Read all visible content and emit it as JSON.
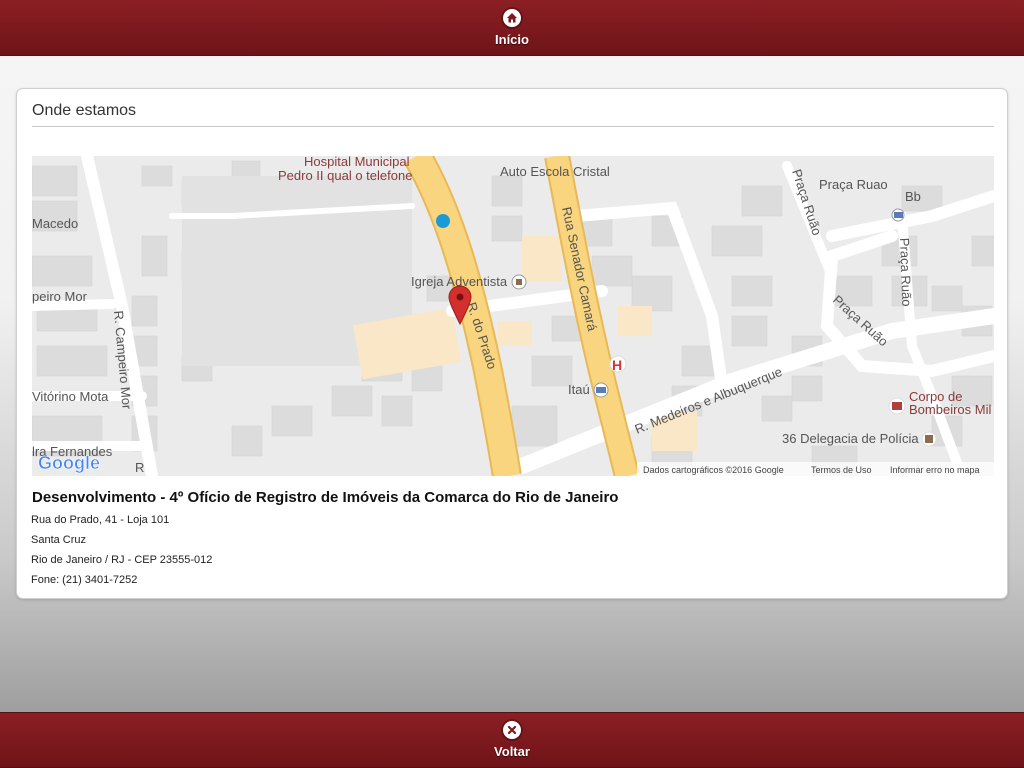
{
  "header": {
    "home_label": "Início",
    "home_icon": "home-icon"
  },
  "card": {
    "title": "Onde estamos",
    "map": {
      "labels": {
        "hospital_line1": "Hospital Municipal",
        "hospital_line2": "Pedro II qual o telefone",
        "auto_escola": "Auto Escola Cristal",
        "praca_ruao_top": "Praça Ruao",
        "bb": "Bb",
        "macedo": "Macedo",
        "igreja": "Igreja Adventista",
        "rua_senador": "Rua Senador Camará",
        "r_do_prado": "R. do Prado",
        "campeiro_mor_left": "peiro Mor",
        "r_campeiro_mor": "R. Campeiro Mor",
        "vitorino": "Vitórino Mota",
        "fernandes": "lra Fernandes",
        "itau": "Itaú",
        "r_medeiros": "R. Medeiros e Albuquerque",
        "praca_ruao_mid": "Praça Ruão",
        "praca_ruao_v1": "Praça Ruão",
        "praca_ruao_v2": "Praça Ruão",
        "corpo_line1": "Corpo de",
        "corpo_line2": "Bombeiros Mil",
        "delegacia": "36 Delegacia de Polícia",
        "hospital_h": "H",
        "r_letter": "R",
        "google": "Google",
        "map_data": "Dados cartográficos ©2016 Google",
        "terms": "Termos de Uso",
        "report": "Informar erro no mapa"
      }
    },
    "office_name": "Desenvolvimento - 4º Ofício de Registro de Imóveis da Comarca do Rio de Janeiro",
    "address": {
      "street": "Rua do Prado, 41 - Loja 101",
      "district": "Santa Cruz",
      "city": "Rio de Janeiro / RJ - CEP 23555-012",
      "phone": "Fone: (21) 3401-7252"
    }
  },
  "footer": {
    "back_label": "Voltar",
    "back_icon": "close-icon"
  },
  "colors": {
    "brand": "#7d1a1f",
    "road_main": "#f8d57e",
    "road_main_edge": "#e8b956",
    "poi_building": "#f9e7c7",
    "pin": "#d32f2f"
  }
}
